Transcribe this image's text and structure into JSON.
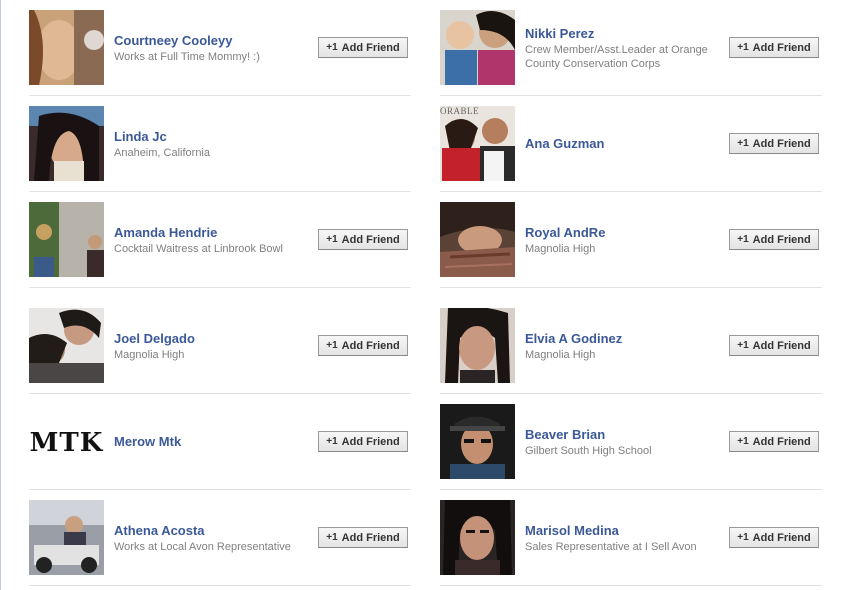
{
  "add_friend_label": "Add Friend",
  "add_icon_text": "+1",
  "mtk_logo_text": "MTK",
  "ana_photo_caption": "ORABLE",
  "colors": {
    "name_link": "#3b5998",
    "subtext": "#808080",
    "divider": "#e0e2e6"
  },
  "people": [
    {
      "name": "Courtneey Cooleyy",
      "subtitle": "Works at Full Time Mommy! :)",
      "has_button": true
    },
    {
      "name": "Nikki Perez",
      "subtitle": "Crew Member/Asst.Leader at Orange County Conservation Corps",
      "has_button": true
    },
    {
      "name": "Linda Jc",
      "subtitle": "Anaheim, California",
      "has_button": false
    },
    {
      "name": "Ana Guzman",
      "subtitle": "",
      "has_button": true
    },
    {
      "name": "Amanda Hendrie",
      "subtitle": "Cocktail Waitress at Linbrook Bowl",
      "has_button": true
    },
    {
      "name": "Royal AndRe",
      "subtitle": "Magnolia High",
      "has_button": true
    },
    {
      "name": "Joel Delgado",
      "subtitle": "Magnolia High",
      "has_button": true
    },
    {
      "name": "Elvia A Godinez",
      "subtitle": "Magnolia High",
      "has_button": true
    },
    {
      "name": "Merow Mtk",
      "subtitle": "",
      "has_button": true
    },
    {
      "name": "Beaver Brian",
      "subtitle": "Gilbert South High School",
      "has_button": true
    },
    {
      "name": "Athena Acosta",
      "subtitle": "Works at Local Avon Representative",
      "has_button": true
    },
    {
      "name": "Marisol Medina",
      "subtitle": "Sales Representative at I Sell Avon",
      "has_button": true
    }
  ]
}
